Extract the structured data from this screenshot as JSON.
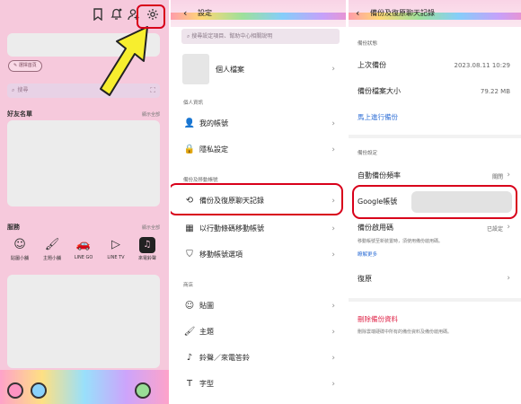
{
  "panel1": {
    "chip_label": "✎ 選擇首頁",
    "search_placeholder": "搜尋",
    "friends_heading": "好友名單",
    "friends_more": "顯示全部",
    "services_heading": "服務",
    "services_more": "顯示全部",
    "services": [
      {
        "icon": "smiley-icon",
        "label": "貼圖小舖",
        "glyph": "☺"
      },
      {
        "icon": "brush-icon",
        "label": "主題小舖",
        "glyph": "🖌"
      },
      {
        "icon": "car-icon",
        "label": "LINE GO",
        "glyph": "🚗"
      },
      {
        "icon": "play-icon",
        "label": "LINE TV",
        "glyph": "▷"
      },
      {
        "icon": "music-store-icon",
        "label": "來電鈴聲",
        "glyph": "♫"
      }
    ],
    "top_icons": [
      "bookmark-icon",
      "bell-icon",
      "add-friend-icon",
      "gear-icon"
    ],
    "highlight_color": "#d8001a",
    "arrow_color": "#f7ee2e"
  },
  "panel2": {
    "title": "設定",
    "search_placeholder": "搜尋設定項目、幫助中心相關說明",
    "profile_label": "個人檔案",
    "sections": [
      {
        "heading": "個人資訊",
        "rows": [
          {
            "icon": "person-icon",
            "glyph": "👤",
            "label": "我的帳號"
          },
          {
            "icon": "privacy-lock-icon",
            "glyph": "🔒",
            "label": "隱私設定"
          }
        ]
      },
      {
        "heading": "備份及移動帳號",
        "rows": [
          {
            "icon": "backup-icon",
            "glyph": "⟲",
            "label": "備份及復原聊天記錄"
          },
          {
            "icon": "qr-code-icon",
            "glyph": "▦",
            "label": "以行動條碼移動帳號"
          },
          {
            "icon": "shield-icon",
            "glyph": "⛉",
            "label": "移動帳號選項"
          }
        ]
      },
      {
        "heading": "商店",
        "rows": [
          {
            "icon": "sticker-icon",
            "glyph": "☺",
            "label": "貼圖"
          },
          {
            "icon": "theme-brush-icon",
            "glyph": "🖌",
            "label": "主題"
          },
          {
            "icon": "music-note-icon",
            "glyph": "♪",
            "label": "鈴聲／來電答鈴"
          },
          {
            "icon": "font-icon",
            "glyph": "T",
            "label": "字型"
          }
        ]
      }
    ]
  },
  "panel3": {
    "title": "備份及復原聊天記錄",
    "status_heading": "備份狀態",
    "last_backup_label": "上次備份",
    "last_backup_value": "2023.08.11 10:29",
    "backup_size_label": "備份檔案大小",
    "backup_size_value": "79.22 MB",
    "backup_now_link": "馬上進行備份",
    "settings_heading": "備份設定",
    "auto_backup_label": "自動備份頻率",
    "auto_backup_value": "關閉",
    "google_account_label": "Google帳號",
    "pin_label": "備份啟用碼",
    "pin_value": "已設定",
    "pin_desc": "移動帳號至新裝置時，須使用備份啟用碼。",
    "learn_more": "瞭解更多",
    "restore_label": "復原",
    "delete_label": "刪除備份資料",
    "delete_desc": "刪除雲端硬碟中所有的備份資料及備份啟用碼。"
  }
}
